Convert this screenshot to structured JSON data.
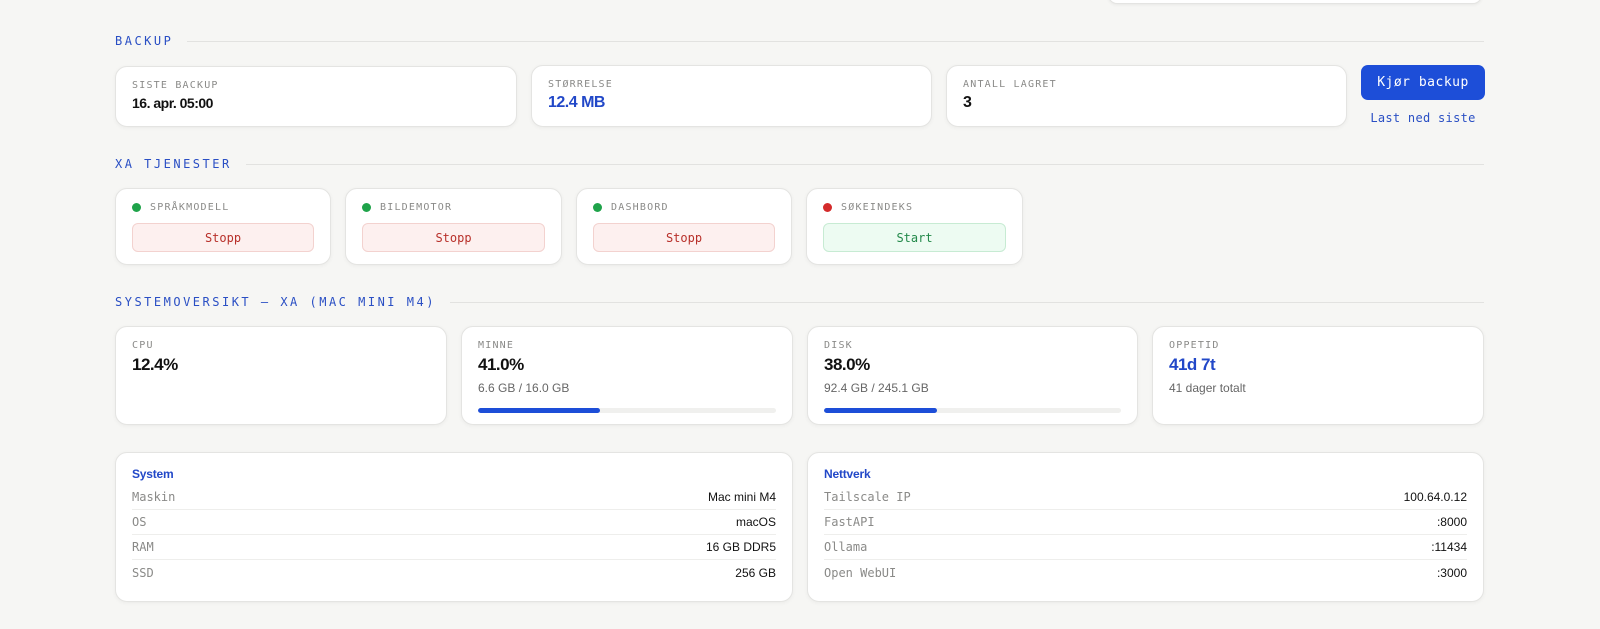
{
  "backup": {
    "section_title": "BACKUP",
    "last_backup_label": "SISTE BACKUP",
    "last_backup_value": "16. apr. 05:00",
    "size_label": "STØRRELSE",
    "size_value": "12.4 MB",
    "stored_label": "ANTALL LAGRET",
    "stored_value": "3",
    "run_button": "Kjør backup",
    "download_link": "Last ned siste"
  },
  "services": {
    "section_title": "XA TJENESTER",
    "items": [
      {
        "name": "SPRÅKMODELL",
        "status": "running",
        "action": "Stopp"
      },
      {
        "name": "BILDEMOTOR",
        "status": "running",
        "action": "Stopp"
      },
      {
        "name": "DASHBORD",
        "status": "running",
        "action": "Stopp"
      },
      {
        "name": "SØKEINDEKS",
        "status": "stopped",
        "action": "Start"
      }
    ]
  },
  "system_overview": {
    "section_title": "SYSTEMOVERSIKT — XA (MAC MINI M4)",
    "cpu": {
      "label": "CPU",
      "value": "12.4%"
    },
    "memory": {
      "label": "MINNE",
      "value": "41.0%",
      "detail": "6.6 GB / 16.0 GB",
      "fraction": 0.41
    },
    "disk": {
      "label": "DISK",
      "value": "38.0%",
      "detail": "92.4 GB / 245.1 GB",
      "fraction": 0.38
    },
    "uptime": {
      "label": "OPPETID",
      "value": "41d 7t",
      "detail": "41 dager totalt"
    }
  },
  "system_panel": {
    "title": "System",
    "rows": [
      {
        "key": "Maskin",
        "value": "Mac mini M4"
      },
      {
        "key": "OS",
        "value": "macOS"
      },
      {
        "key": "RAM",
        "value": "16 GB DDR5"
      },
      {
        "key": "SSD",
        "value": "256 GB"
      }
    ]
  },
  "network_panel": {
    "title": "Nettverk",
    "rows": [
      {
        "key": "Tailscale IP",
        "value": "100.64.0.12"
      },
      {
        "key": "FastAPI",
        "value": ":8000"
      },
      {
        "key": "Ollama",
        "value": ":11434"
      },
      {
        "key": "Open WebUI",
        "value": ":3000"
      }
    ]
  },
  "colors": {
    "accent": "#1d4ed8",
    "running": "#1fa34a",
    "stopped": "#d42b2b"
  }
}
